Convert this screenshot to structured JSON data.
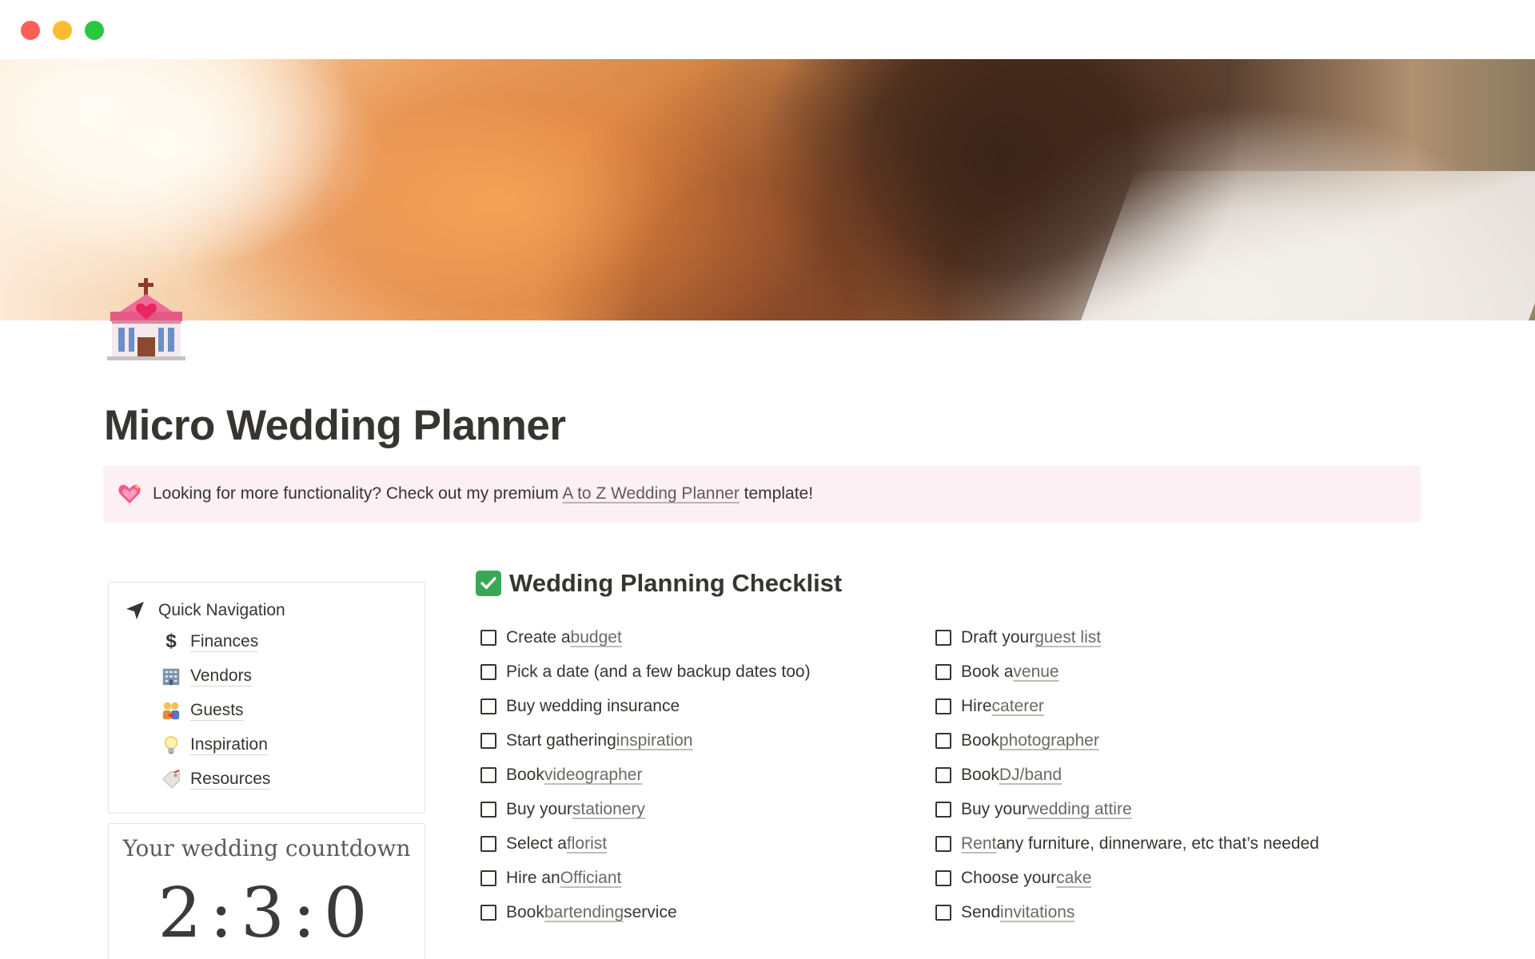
{
  "window": {
    "controls": [
      "close",
      "minimize",
      "maximize"
    ]
  },
  "page": {
    "title": "Micro Wedding Planner",
    "icon": "wedding-chapel-icon"
  },
  "callout": {
    "icon": "sparkling-heart-icon",
    "text_before": "Looking for more functionality? Check out my premium ",
    "link": "A to Z Wedding Planner",
    "text_after": " template!"
  },
  "navigation": {
    "title": "Quick Navigation",
    "items": [
      {
        "label": "Finances",
        "icon": "dollar-icon"
      },
      {
        "label": "Vendors",
        "icon": "office-building-icon"
      },
      {
        "label": "Guests",
        "icon": "couple-icon"
      },
      {
        "label": "Inspiration",
        "icon": "lightbulb-icon"
      },
      {
        "label": "Resources",
        "icon": "label-tag-icon"
      }
    ]
  },
  "countdown": {
    "title": "Your wedding countdown",
    "value": "2:3:0"
  },
  "checklist": {
    "title": "Wedding Planning Checklist",
    "left": [
      {
        "pre": "Create a ",
        "link": "budget",
        "post": ""
      },
      {
        "pre": "Pick a date (and a few backup dates too)",
        "link": "",
        "post": ""
      },
      {
        "pre": "Buy wedding insurance",
        "link": "",
        "post": ""
      },
      {
        "pre": "Start gathering ",
        "link": "inspiration",
        "post": ""
      },
      {
        "pre": "Book ",
        "link": "videographer",
        "post": ""
      },
      {
        "pre": "Buy your ",
        "link": "stationery",
        "post": ""
      },
      {
        "pre": "Select a ",
        "link": "florist",
        "post": ""
      },
      {
        "pre": "Hire an ",
        "link": "Officiant",
        "post": ""
      },
      {
        "pre": "Book ",
        "link": "bartending",
        "post": " service"
      }
    ],
    "right": [
      {
        "pre": "Draft your ",
        "link": "guest list",
        "post": ""
      },
      {
        "pre": "Book a ",
        "link": "venue",
        "post": ""
      },
      {
        "pre": "Hire ",
        "link": "caterer",
        "post": ""
      },
      {
        "pre": "Book ",
        "link": "photographer",
        "post": ""
      },
      {
        "pre": "Book ",
        "link": "DJ/band",
        "post": ""
      },
      {
        "pre": "Buy your ",
        "link": "wedding attire",
        "post": ""
      },
      {
        "pre": "",
        "link": "Rent",
        "post": " any furniture, dinnerware, etc that’s needed"
      },
      {
        "pre": "Choose your ",
        "link": "cake",
        "post": ""
      },
      {
        "pre": "Send ",
        "link": "invitations",
        "post": ""
      }
    ]
  }
}
